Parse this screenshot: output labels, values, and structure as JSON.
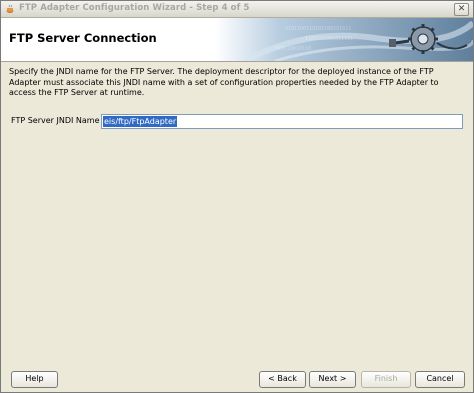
{
  "window": {
    "title": "FTP Adapter Configuration Wizard - Step 4 of 5",
    "close_glyph": "✕"
  },
  "header": {
    "title": "FTP Server Connection"
  },
  "description": "Specify the JNDI name for the FTP Server.  The deployment descriptor for the deployed instance of the FTP Adapter must associate this JNDI name with a set of configuration properties needed by the FTP Adapter to access the FTP Server at runtime.",
  "form": {
    "jndi_label": "FTP Server JNDI Name",
    "jndi_value": "eis/ftp/FtpAdapter"
  },
  "buttons": {
    "help": "Help",
    "back": "< Back",
    "next": "Next >",
    "finish": "Finish",
    "cancel": "Cancel"
  },
  "colors": {
    "selection": "#316ac5",
    "input_border": "#7f9db9",
    "dialog_bg": "#ece9d8"
  },
  "icons": {
    "app": "java-cup-icon",
    "banner": "gear-plug-icon"
  }
}
